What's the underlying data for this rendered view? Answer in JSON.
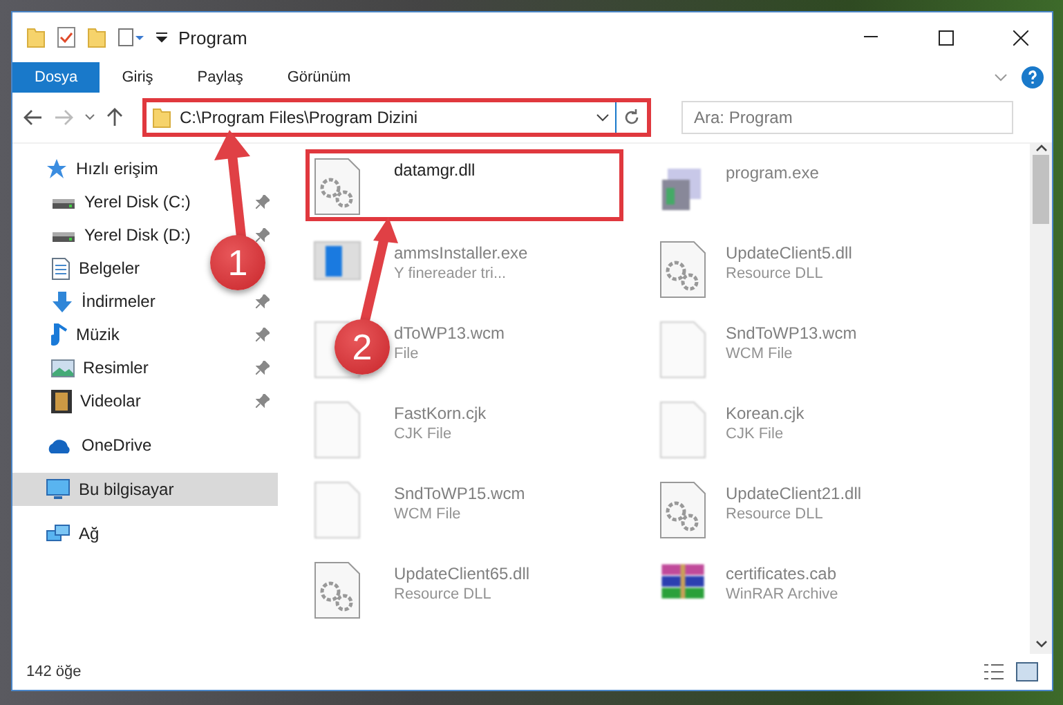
{
  "window": {
    "title": "Program"
  },
  "ribbon_tabs": [
    {
      "label": "Dosya",
      "selected": true
    },
    {
      "label": "Giriş",
      "selected": false
    },
    {
      "label": "Paylaş",
      "selected": false
    },
    {
      "label": "Görünüm",
      "selected": false
    }
  ],
  "address": {
    "path": "C:\\Program Files\\Program Dizini",
    "highlighted": true
  },
  "search": {
    "placeholder": "Ara: Program"
  },
  "nav": [
    {
      "label": "Hızlı erişim",
      "kind": "star",
      "pinned": false,
      "selected": false,
      "children": [
        {
          "label": "Yerel Disk (C:)",
          "kind": "drive",
          "pinned": true,
          "selected": false
        },
        {
          "label": "Yerel Disk (D:)",
          "kind": "drive",
          "pinned": true,
          "selected": false
        },
        {
          "label": "Belgeler",
          "kind": "documents",
          "pinned": false,
          "selected": false
        },
        {
          "label": "İndirmeler",
          "kind": "download",
          "pinned": true,
          "selected": false
        },
        {
          "label": "Müzik",
          "kind": "music",
          "pinned": true,
          "selected": false
        },
        {
          "label": "Resimler",
          "kind": "pictures",
          "pinned": true,
          "selected": false
        },
        {
          "label": "Videolar",
          "kind": "videos",
          "pinned": true,
          "selected": false
        }
      ]
    },
    {
      "label": "OneDrive",
      "kind": "cloud",
      "pinned": false,
      "selected": false
    },
    {
      "label": "Bu bilgisayar",
      "kind": "computer",
      "pinned": false,
      "selected": true
    },
    {
      "label": "Ağ",
      "kind": "network",
      "pinned": false,
      "selected": false
    }
  ],
  "files": [
    {
      "name": "datamgr.dll",
      "kind": "dll",
      "blurred": false,
      "highlighted": true
    },
    {
      "name": "program.exe",
      "kind": "exe",
      "blurred": true,
      "highlighted": false
    },
    {
      "name": "ammsInstaller.exe",
      "type": "Y finereader tri...",
      "kind": "installer",
      "blurred": true,
      "highlighted": false
    },
    {
      "name": "UpdateClient5.dll",
      "type": "Resource DLL",
      "kind": "dll",
      "blurred": true,
      "highlighted": false
    },
    {
      "name": "dToWP13.wcm",
      "type": "File",
      "kind": "blank",
      "blurred": true,
      "highlighted": false
    },
    {
      "name": "SndToWP13.wcm",
      "type": "WCM File",
      "kind": "blank",
      "blurred": true,
      "highlighted": false
    },
    {
      "name": "FastKorn.cjk",
      "type": "CJK File",
      "kind": "blank",
      "blurred": true,
      "highlighted": false
    },
    {
      "name": "Korean.cjk",
      "type": "CJK File",
      "kind": "blank",
      "blurred": true,
      "highlighted": false
    },
    {
      "name": "SndToWP15.wcm",
      "type": "WCM File",
      "kind": "blank",
      "blurred": true,
      "highlighted": false
    },
    {
      "name": "UpdateClient21.dll",
      "type": "Resource DLL",
      "kind": "dll",
      "blurred": true,
      "highlighted": false
    },
    {
      "name": "UpdateClient65.dll",
      "type": "Resource DLL",
      "kind": "dll",
      "blurred": true,
      "highlighted": false
    },
    {
      "name": "certificates.cab",
      "type": "WinRAR Archive",
      "kind": "cab",
      "blurred": true,
      "highlighted": false
    }
  ],
  "status_bar": {
    "count": "142 öğe"
  },
  "steps": [
    {
      "number": "1"
    },
    {
      "number": "2"
    }
  ]
}
